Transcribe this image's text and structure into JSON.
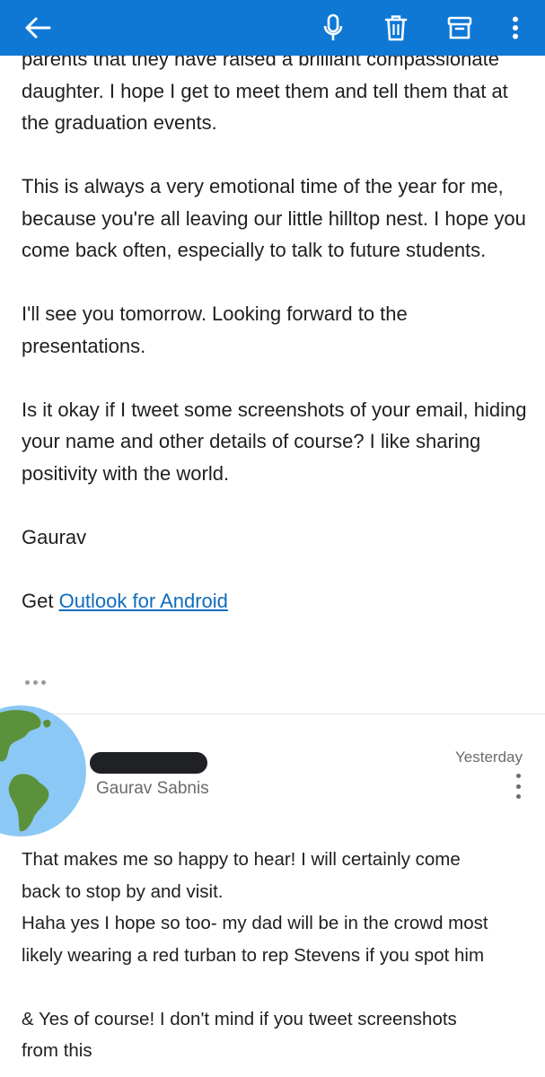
{
  "toolbar": {
    "back_icon": "back-arrow-icon",
    "dictate_icon": "microphone-icon",
    "delete_icon": "trash-icon",
    "archive_icon": "archive-icon",
    "more_icon": "more-vertical-icon",
    "accent_color": "#0f78d4"
  },
  "message1": {
    "paragraphs": [
      "parents that they have raised a brilliant compassionate daughter. I hope I get to meet them and tell them that at the graduation events.",
      "This is always a very emotional time of the year for me, because you're all leaving our little hilltop nest. I hope you come back often, especially to talk to future students.",
      "I'll see you tomorrow. Looking forward to the presentations.",
      "Is it okay if I tweet some screenshots of your email, hiding your name and other details of course? I like sharing positivity with the world.",
      "Gaurav"
    ],
    "signature_prefix": "Get ",
    "signature_link": "Outlook for Android",
    "link_color": "#0f6cbd"
  },
  "message2": {
    "recipient": "Gaurav Sabnis",
    "date": "Yesterday",
    "avatar_icon": "globe-americas-icon",
    "lines": [
      "That makes me so happy to hear! I will certainly come",
      "back to stop by and visit.",
      "Haha yes I hope so too- my dad will be in the crowd most",
      "likely wearing a red turban to rep Stevens if you spot him",
      "",
      "& Yes of course! I don't mind if you tweet screenshots",
      "from this"
    ]
  }
}
